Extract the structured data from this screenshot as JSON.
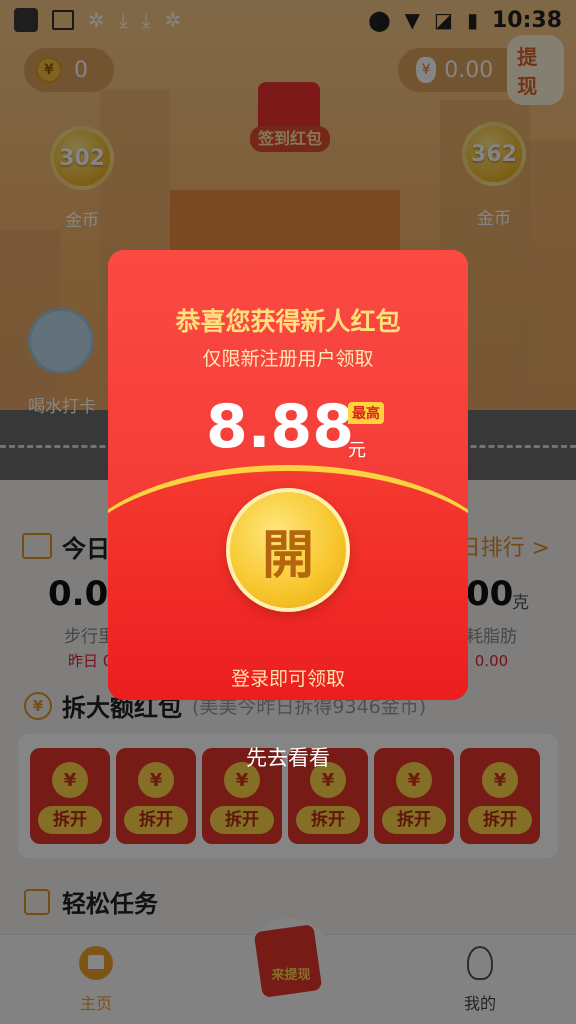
{
  "status_bar": {
    "time": "10:38"
  },
  "header": {
    "coins": "0",
    "money": "0.00",
    "withdraw_label": "提现",
    "bubble_left_value": "302",
    "bubble_left_label": "金币",
    "bubble_right_value": "362",
    "bubble_right_label": "金币",
    "signin_label": "签到红包",
    "signin_char": "開",
    "water_label": "喝水打卡"
  },
  "today": {
    "title_partial": "今日",
    "rank_label": "日排行 >",
    "steps_value_partial": "0.00",
    "steps_label_partial": "步行里",
    "steps_yesterday_partial": "昨日 0",
    "fat_value_partial": "00",
    "fat_unit": "克",
    "fat_label_partial": "耗脂肪",
    "fat_yesterday_partial": "昨日 0.00"
  },
  "redpacket_section": {
    "title": "拆大额红包",
    "note": "(美美今昨日拆得9346金币)",
    "envelopes": [
      {
        "yen": "¥",
        "label": "拆开"
      },
      {
        "yen": "¥",
        "label": "拆开"
      },
      {
        "yen": "¥",
        "label": "拆开"
      },
      {
        "yen": "¥",
        "label": "拆开"
      },
      {
        "yen": "¥",
        "label": "拆开"
      },
      {
        "yen": "¥",
        "label": "拆开"
      }
    ]
  },
  "tasks": {
    "title": "轻松任务"
  },
  "tabbar": {
    "home": "主页",
    "center": "来提现",
    "mine": "我的"
  },
  "modal": {
    "title": "恭喜您获得新人红包",
    "subtitle": "仅限新注册用户领取",
    "amount": "8.88",
    "max_badge": "最高",
    "unit": "元",
    "open_char": "開",
    "login_hint": "登录即可领取"
  },
  "look_first": "先去看看",
  "colors": {
    "accent": "#f5362f",
    "gold": "#fbd23f",
    "orange": "#e0962a"
  }
}
